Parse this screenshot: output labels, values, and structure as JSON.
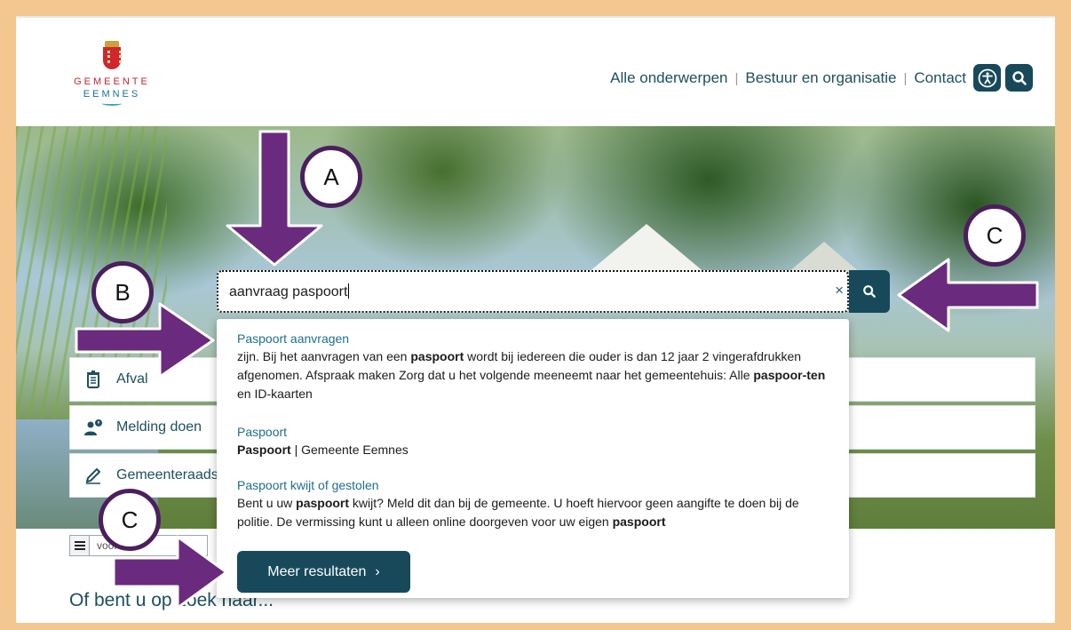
{
  "logo": {
    "line1": "GEMEENTE",
    "line2": "EEMNES"
  },
  "topnav": {
    "items": [
      "Alle onderwerpen",
      "Bestuur en organisatie",
      "Contact"
    ],
    "separator": "|"
  },
  "icons": {
    "accessibility": "accessibility-icon",
    "search": "search-icon",
    "clear": "close-icon"
  },
  "search": {
    "value": "aanvraag paspoort",
    "clear_label": "×"
  },
  "results": [
    {
      "title": "Paspoort aanvragen",
      "desc_parts": [
        {
          "t": "zijn. Bij het aanvragen van een "
        },
        {
          "t": "paspoort",
          "b": true
        },
        {
          "t": " wordt bij iedereen die ouder is dan 12 jaar 2 vingerafdrukken afgenomen. Afspraak maken Zorg dat u het volgende meeneemt naar het gemeentehuis: Alle "
        },
        {
          "t": "paspoor-ten",
          "b": true
        },
        {
          "t": " en ID-kaarten"
        }
      ]
    },
    {
      "title": "Paspoort",
      "desc_parts": [
        {
          "t": "Paspoort",
          "b": true
        },
        {
          "t": " | Gemeente Eemnes"
        }
      ]
    },
    {
      "title": "Paspoort kwijt of gestolen",
      "desc_parts": [
        {
          "t": "Bent u uw "
        },
        {
          "t": "paspoort",
          "b": true
        },
        {
          "t": " kwijt? Meld dit dan bij de gemeente. U hoeft hiervoor geen aangifte te doen bij de politie. De vermissing kunt u alleen online doorgeven voor uw eigen "
        },
        {
          "t": "paspoort",
          "b": true
        }
      ]
    }
  ],
  "more_button": {
    "label": "Meer resultaten",
    "chevron": "›"
  },
  "tiles": [
    "Afval",
    "Melding doen",
    "Gemeenteraads"
  ],
  "view_toggle_text": "voor",
  "below_title": "Of bent u op zoek naar...",
  "annotations": {
    "a": "A",
    "b": "B",
    "c1": "C",
    "c2": "C"
  },
  "colors": {
    "accent": "#17495a",
    "link": "#1f6f8b",
    "annotation": "#6a2a7e",
    "frame": "#f3c78f"
  }
}
